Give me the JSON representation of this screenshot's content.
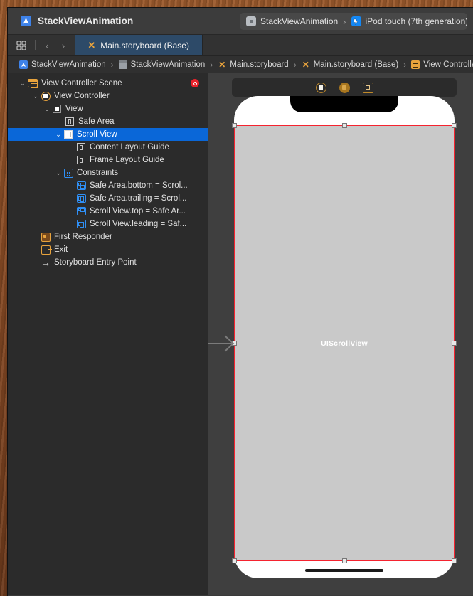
{
  "window": {
    "title": "StackViewAnimation",
    "app_icon": "xcode-app-icon"
  },
  "scheme": {
    "target": "StackViewAnimation",
    "destination": "iPod touch (7th generation)",
    "separator": "›",
    "target_icon": "app-target-icon",
    "destination_icon": "simulator-device-icon"
  },
  "tabbar": {
    "grid_icon": "tab-grid-icon",
    "back_icon": "‹",
    "forward_icon": "›",
    "tabs": [
      {
        "label": "Main.storyboard (Base)",
        "icon": "storyboard-icon",
        "active": true
      }
    ]
  },
  "breadcrumb": {
    "separator": "›",
    "items": [
      {
        "label": "StackViewAnimation",
        "icon": "project-icon"
      },
      {
        "label": "StackViewAnimation",
        "icon": "folder-icon"
      },
      {
        "label": "Main.storyboard",
        "icon": "storyboard-icon"
      },
      {
        "label": "Main.storyboard (Base)",
        "icon": "storyboard-icon"
      },
      {
        "label": "View Controlle",
        "icon": "view-controller-icon"
      }
    ]
  },
  "outline": {
    "error_badge": "error-badge",
    "rows": [
      {
        "label": "View Controller Scene",
        "icon": "scene-icon",
        "indent": 0,
        "disclosure": "⌄",
        "selected": false,
        "error": true
      },
      {
        "label": "View Controller",
        "icon": "view-controller-icon",
        "indent": 1,
        "disclosure": "⌄",
        "selected": false,
        "error": false
      },
      {
        "label": "View",
        "icon": "view-icon",
        "indent": 2,
        "disclosure": "⌄",
        "selected": false,
        "error": false
      },
      {
        "label": "Safe Area",
        "icon": "layout-guide-icon",
        "indent": 3,
        "disclosure": "",
        "selected": false,
        "error": false
      },
      {
        "label": "Scroll View",
        "icon": "scroll-view-icon",
        "indent": 3,
        "disclosure": "⌄",
        "selected": true,
        "error": false
      },
      {
        "label": "Content Layout Guide",
        "icon": "layout-guide-icon",
        "indent": 4,
        "disclosure": "",
        "selected": false,
        "error": false
      },
      {
        "label": "Frame Layout Guide",
        "icon": "layout-guide-icon",
        "indent": 4,
        "disclosure": "",
        "selected": false,
        "error": false
      },
      {
        "label": "Constraints",
        "icon": "constraints-icon",
        "indent": 3,
        "disclosure": "⌄",
        "selected": false,
        "error": false
      },
      {
        "label": "Safe Area.bottom = Scrol...",
        "icon": "constraint-bottom-icon",
        "indent": 4,
        "disclosure": "",
        "selected": false,
        "error": false
      },
      {
        "label": "Safe Area.trailing = Scrol...",
        "icon": "constraint-trailing-icon",
        "indent": 4,
        "disclosure": "",
        "selected": false,
        "error": false
      },
      {
        "label": "Scroll View.top = Safe Ar...",
        "icon": "constraint-top-icon",
        "indent": 4,
        "disclosure": "",
        "selected": false,
        "error": false
      },
      {
        "label": "Scroll View.leading = Saf...",
        "icon": "constraint-leading-icon",
        "indent": 4,
        "disclosure": "",
        "selected": false,
        "error": false
      },
      {
        "label": "First Responder",
        "icon": "first-responder-icon",
        "indent": 2,
        "disclosure": "",
        "selected": false,
        "error": false
      },
      {
        "label": "Exit",
        "icon": "exit-icon",
        "indent": 2,
        "disclosure": "",
        "selected": false,
        "error": false
      },
      {
        "label": "Storyboard Entry Point",
        "icon": "entry-point-icon",
        "indent": 2,
        "disclosure": "",
        "selected": false,
        "error": false
      }
    ]
  },
  "canvas": {
    "scene_dock": [
      {
        "icon": "view-controller-dock-icon",
        "name": "view-controller"
      },
      {
        "icon": "first-responder-dock-icon",
        "name": "first-responder"
      },
      {
        "icon": "exit-dock-icon",
        "name": "exit"
      }
    ],
    "selected_view_label": "UIScrollView",
    "selection_color": "#f5232f",
    "scroll_view_fill": "#c9c9c9",
    "entry_point_arrow": "storyboard-entry-arrow"
  }
}
